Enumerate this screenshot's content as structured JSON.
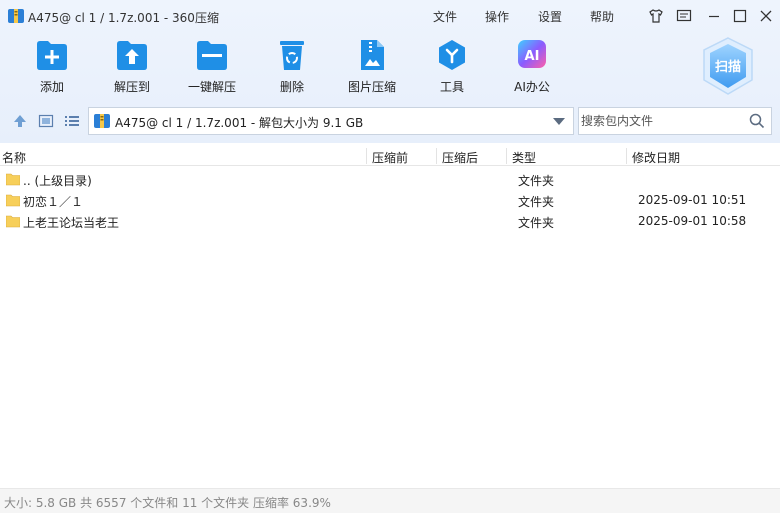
{
  "window": {
    "title": "A475@ cl 1 / 1.7z.001 - 360压缩"
  },
  "menu": {
    "file": "文件",
    "operate": "操作",
    "settings": "设置",
    "help": "帮助"
  },
  "toolbar": {
    "add": "添加",
    "extract_to": "解压到",
    "one_click_extract": "一键解压",
    "delete": "删除",
    "image_compress": "图片压缩",
    "tools": "工具",
    "ai_office": "AI办公",
    "ai_badge": "AI",
    "scan": "扫描"
  },
  "address": {
    "path": "A475@ cl 1 / 1.7z.001 - 解包大小为 9.1 GB"
  },
  "search": {
    "placeholder": "搜索包内文件"
  },
  "columns": {
    "name": "名称",
    "packed": "压缩前",
    "compressed": "压缩后",
    "type": "类型",
    "modified": "修改日期"
  },
  "rows": [
    {
      "name": ".. (上级目录)",
      "type": "文件夹",
      "date": ""
    },
    {
      "name": "初恋１／１",
      "type": "文件夹",
      "date": "2025-09-01 10:51"
    },
    {
      "name": "上老王论坛当老王",
      "type": "文件夹",
      "date": "2025-09-01 10:58"
    }
  ],
  "status": {
    "text": "大小: 5.8 GB 共 6557 个文件和 11 个文件夹 压缩率 63.9%"
  },
  "colors": {
    "accent": "#1f8fe6",
    "folder": "#f7cf5a",
    "toolbar_bg": "#eaf1fc"
  }
}
